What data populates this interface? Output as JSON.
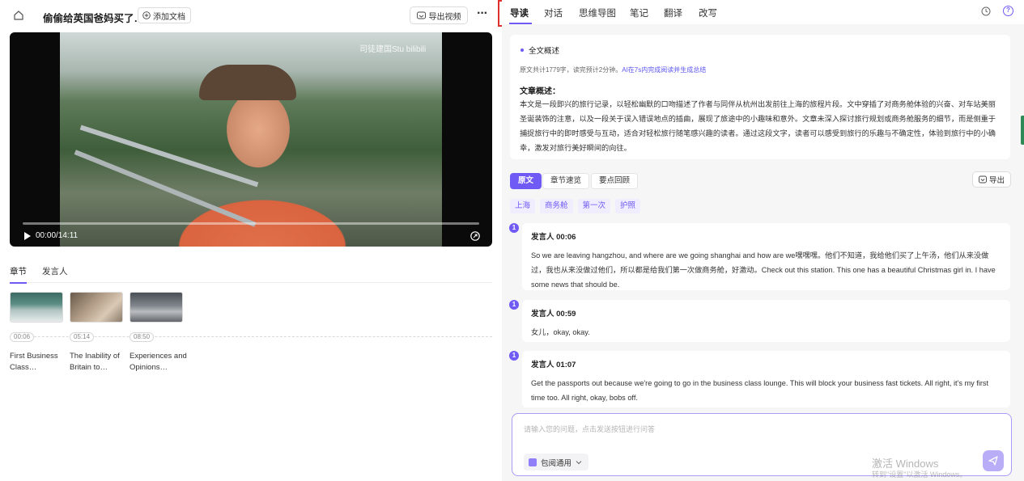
{
  "left": {
    "doc_title": "偷偷给英国爸妈买了…",
    "add_doc_label": "添加文档",
    "export_video_label": "导出视频",
    "more_label": "···",
    "video": {
      "watermark": "司徒建国Stu bilibili",
      "time": "00:00/14:11"
    },
    "tabs": [
      {
        "label": "章节",
        "active": true
      },
      {
        "label": "发言人",
        "active": false
      }
    ],
    "chapters": [
      {
        "time": "00:06",
        "title": "First Business Class…"
      },
      {
        "time": "05:14",
        "title": "The Inability of Britain to…"
      },
      {
        "time": "08:50",
        "title": "Experiences and Opinions…"
      }
    ]
  },
  "right": {
    "tabs": [
      {
        "label": "导读",
        "active": true
      },
      {
        "label": "对话",
        "active": false
      },
      {
        "label": "思维导图",
        "active": false
      },
      {
        "label": "笔记",
        "active": false
      },
      {
        "label": "翻译",
        "active": false
      },
      {
        "label": "改写",
        "active": false
      }
    ],
    "summary": {
      "heading": "全文概述",
      "meta": "原文共计1779字，读完预计2分钟。",
      "ai_note": "AI在7s内完成阅读并生成总结",
      "title": "文章概述：",
      "text": "本文是一段即兴的旅行记录，以轻松幽默的口吻描述了作者与同伴从杭州出发前往上海的旅程片段。文中穿插了对商务舱体验的兴奋、对车站美丽圣诞装饰的注意，以及一段关于误入错误地点的插曲，展现了旅途中的小趣味和意外。文章未深入探讨旅行规划或商务舱服务的细节，而是侧重于捕捉旅行中的即时感受与互动，适合对轻松旅行随笔感兴趣的读者。通过这段文字，读者可以感受到旅行的乐趣与不确定性，体验到旅行中的小确幸，激发对旅行美好瞬间的向往。"
    },
    "view_tabs": [
      {
        "label": "原文",
        "active": true
      },
      {
        "label": "章节速览",
        "active": false
      },
      {
        "label": "要点回顾",
        "active": false
      }
    ],
    "export_label": "导出",
    "tags": [
      "上海",
      "商务舱",
      "第一次",
      "护照"
    ],
    "transcript": [
      {
        "badge": "1",
        "speaker": "发言人 00:06",
        "text": "So we are leaving hangzhou, and where are we going shanghai and how are we嘿嘿嘿。他们不知道，我给他们买了上午汤，他们从来没做过，我也从来没做过他们，所以都是给我们第一次做商务舱，好激动。Check out this station. This one has a beautiful Christmas girl in. I have some news that should be."
      },
      {
        "badge": "1",
        "speaker": "发言人 00:59",
        "text": "女儿，okay, okay."
      },
      {
        "badge": "1",
        "speaker": "发言人 01:07",
        "text": "Get the passports out because we're going to go in the business class lounge. This will block your business fast tickets. All right, it's my first time too. All right, okay, bobs off."
      }
    ],
    "chat": {
      "placeholder": "请输入您的问题，点击发送按钮进行问答",
      "model_label": "包阅通用"
    },
    "os_watermark": {
      "title": "激活 Windows",
      "subtitle": "转到\"设置\"以激活 Windows。"
    },
    "colors": {
      "accent": "#6f5af6",
      "highlight_box": "#e0302b"
    }
  }
}
